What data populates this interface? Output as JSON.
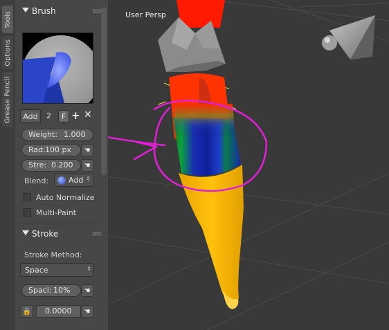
{
  "tabs": [
    "Tools",
    "Options",
    "Grease Pencil"
  ],
  "brush_panel": {
    "title": "Brush",
    "add_label": "Add",
    "users": "2",
    "fake_user": "F",
    "weight_label": "Weight:",
    "weight_value": "1.000",
    "radius_label": "Rad:",
    "radius_value": "100 px",
    "strength_label": "Stre:",
    "strength_value": "0.200",
    "blend_label": "Blend:",
    "blend_value": "Add",
    "auto_normalize": "Auto Normalize",
    "multi_paint": "Multi-Paint"
  },
  "stroke_panel": {
    "title": "Stroke",
    "method_label": "Stroke Method:",
    "method_value": "Space",
    "spacing_label": "Spaci:",
    "spacing_value": "10%",
    "jitter_value": "0.0000"
  },
  "viewport": {
    "label": "User Persp"
  },
  "colors": {
    "annotation": "#e01fd6",
    "panel_bg": "#474747",
    "viewport_bg": "#393939"
  }
}
